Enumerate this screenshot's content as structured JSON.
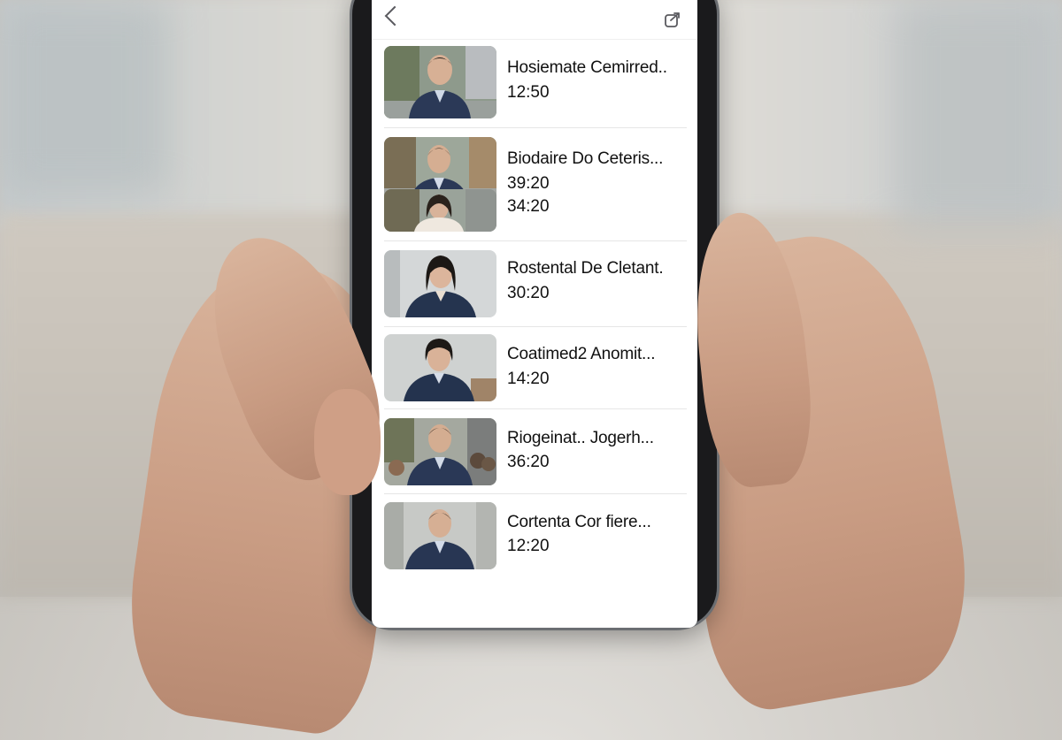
{
  "header": {
    "back_icon": "chevron-left-icon",
    "share_icon": "share-icon"
  },
  "videos": [
    {
      "title": "Hosiemate Cemirred..",
      "duration": "12:50",
      "thumb": "man-street"
    },
    {
      "title": "Biodaire Do Ceteris...",
      "duration": "39:20",
      "thumb": "man-street"
    },
    {
      "title": "",
      "duration": "34:20",
      "thumb": "woman-street"
    },
    {
      "title": "Rostental De Cletant.",
      "duration": "30:20",
      "thumb": "woman-indoor"
    },
    {
      "title": "Coatimed2 Anomit...",
      "duration": "14:20",
      "thumb": "woman-indoor"
    },
    {
      "title": "Riogeinat..  Jogerh...",
      "duration": "36:20",
      "thumb": "man-crowd"
    },
    {
      "title": "Cortenta Cor fiere...",
      "duration": "12:20",
      "thumb": "man-indoor"
    }
  ],
  "colors": {
    "accent": "#1a2b4a",
    "text": "#111111",
    "separator": "#e6e6e6"
  }
}
